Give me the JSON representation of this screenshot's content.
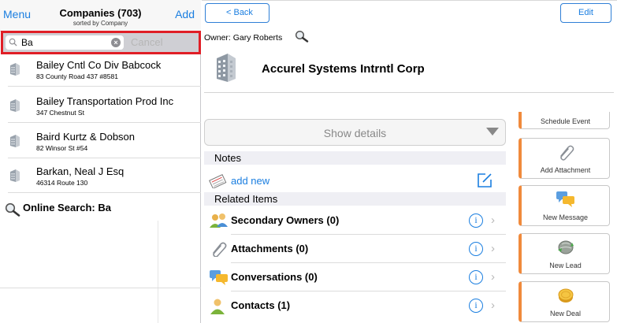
{
  "left_nav": {
    "menu_label": "Menu",
    "title": "Companies (703)",
    "subtitle": "sorted by Company",
    "add_label": "Add"
  },
  "search": {
    "value": "Ba",
    "cancel_label": "Cancel"
  },
  "results": [
    {
      "name": "Bailey Cntl Co Div Babcock",
      "address": "83 County Road 437 #8581"
    },
    {
      "name": "Bailey Transportation Prod Inc",
      "address": "347 Chestnut St"
    },
    {
      "name": "Baird Kurtz & Dobson",
      "address": "82 Winsor St #54"
    },
    {
      "name": "Barkan, Neal J Esq",
      "address": "46314 Route 130"
    }
  ],
  "online_search_label": "Online Search: Ba",
  "detail": {
    "back_label": "< Back",
    "edit_label": "Edit",
    "owner": "Owner: Gary Roberts",
    "company_name": "Accurel Systems Intrntl Corp",
    "show_details_label": "Show details",
    "notes_header": "Notes",
    "add_new_label": "add new",
    "related_header": "Related Items",
    "related_items": [
      {
        "label": "Secondary Owners (0)",
        "icon": "people-icon"
      },
      {
        "label": "Attachments (0)",
        "icon": "paperclip-icon"
      },
      {
        "label": "Conversations (0)",
        "icon": "chat-bubbles-icon"
      },
      {
        "label": "Contacts (1)",
        "icon": "person-icon"
      }
    ]
  },
  "actions": {
    "schedule_event": "Schedule Event",
    "add_attachment": "Add Attachment",
    "new_message": "New Message",
    "new_lead": "New Lead",
    "new_deal": "New Deal"
  },
  "colors": {
    "accent": "#1a7ee0",
    "highlight_border": "#e01e26",
    "action_stripe": "#f08a3c"
  }
}
